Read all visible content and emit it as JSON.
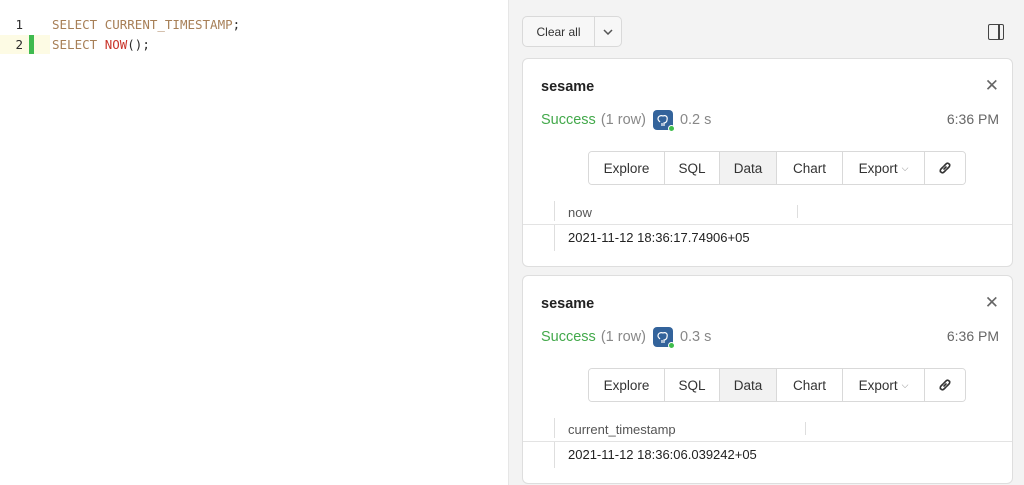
{
  "editor": {
    "lines": [
      {
        "number": "1",
        "keyword": "SELECT",
        "fn": "CURRENT_TIMESTAMP",
        "punct": ";"
      },
      {
        "number": "2",
        "keyword": "SELECT",
        "fn": "NOW",
        "punct": "();"
      }
    ]
  },
  "toolbar": {
    "clear_label": "Clear all",
    "dropdown_icon": "chevron-down-icon",
    "panel_icon": "panel-toggle-icon"
  },
  "results": [
    {
      "connection": "sesame",
      "status": "Success",
      "rows": "(1 row)",
      "duration": "0.2 s",
      "time": "6:36 PM",
      "tabs": [
        "Explore",
        "SQL",
        "Data",
        "Chart",
        "Export"
      ],
      "active_tab": "Data",
      "column": "now",
      "value": "2021-11-12 18:36:17.74906+05"
    },
    {
      "connection": "sesame",
      "status": "Success",
      "rows": "(1 row)",
      "duration": "0.3 s",
      "time": "6:36 PM",
      "tabs": [
        "Explore",
        "SQL",
        "Data",
        "Chart",
        "Export"
      ],
      "active_tab": "Data",
      "column": "current_timestamp",
      "value": "2021-11-12 18:36:06.039242+05"
    }
  ],
  "colors": {
    "success": "#43a94b",
    "db_icon": "#33639b",
    "online_dot": "#3fbd4c",
    "keyword": "#a77f57",
    "function": "#c9342a",
    "line_marker": "#3fba4f"
  }
}
